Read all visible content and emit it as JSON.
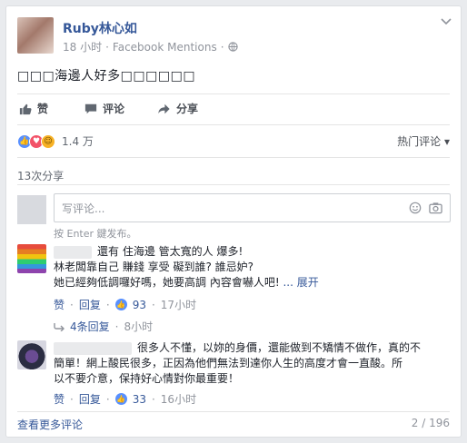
{
  "post": {
    "author": "Ruby林心如",
    "time": "18 小时",
    "separator": "·",
    "source": "Facebook Mentions",
    "separator2": "·",
    "text": "□□□海邊人好多□□□□□□",
    "actions": {
      "like": "赞",
      "comment": "评论",
      "share": "分享"
    }
  },
  "summary": {
    "reaction_count": "1.4 万",
    "sort_label": "热门评论",
    "shares": "13次分享"
  },
  "composer": {
    "placeholder": "写评论...",
    "hint": "按 Enter 鍵发布。"
  },
  "comments": [
    {
      "lines": [
        "還有 住海邊 管太寬的人 爆多!",
        "林老闆靠自己 賺錢 享受 礙到誰? 誰忌妒?",
        "她已經夠低調囉好嗎，她要高調 內容會嚇人吧!"
      ],
      "more": "... 展开",
      "like": "赞",
      "reply": "回复",
      "likes": "93",
      "time": "17小时",
      "replies": "4条回复",
      "replies_time": "8小时"
    },
    {
      "lines": [
        "很多人不懂，以妳的身價，還能做到不矯情不做作，真的不",
        "簡單！網上酸民很多，正因為他們無法到達你人生的高度才會一直酸。所",
        "以不要介意，保持好心情對你最重要！"
      ],
      "like": "赞",
      "reply": "回复",
      "likes": "33",
      "time": "16小时"
    }
  ],
  "footer": {
    "see_more": "查看更多评论",
    "pager": "2 / 196"
  },
  "colors": {
    "link": "#365899",
    "muted": "#90949c",
    "like_blue": "#5890ff",
    "love_red": "#f25268",
    "haha_yellow": "#f7b125"
  }
}
